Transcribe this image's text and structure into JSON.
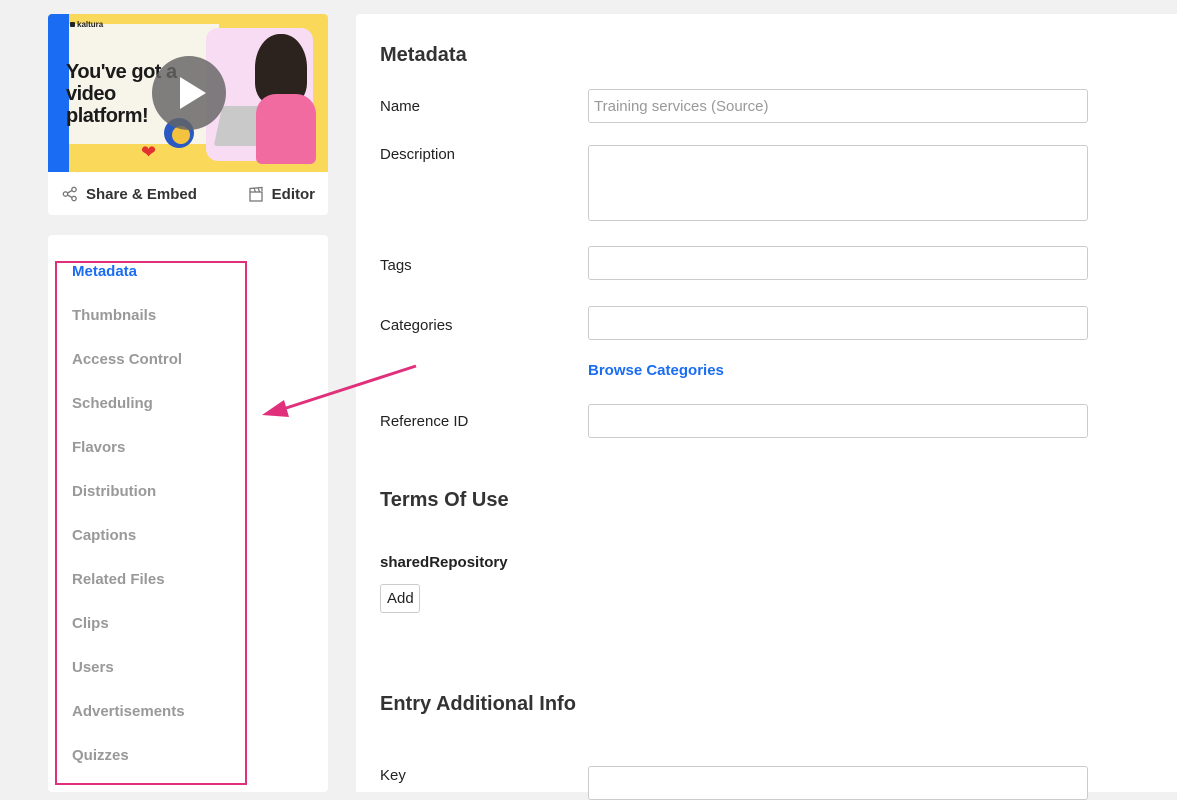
{
  "video": {
    "brand": "kaltura",
    "headline": "You've got a video platform!"
  },
  "actions": {
    "share_label": "Share & Embed",
    "editor_label": "Editor"
  },
  "nav": {
    "items": [
      {
        "label": "Metadata",
        "active": true
      },
      {
        "label": "Thumbnails"
      },
      {
        "label": "Access Control"
      },
      {
        "label": "Scheduling"
      },
      {
        "label": "Flavors"
      },
      {
        "label": "Distribution"
      },
      {
        "label": "Captions"
      },
      {
        "label": "Related Files"
      },
      {
        "label": "Clips"
      },
      {
        "label": "Users"
      },
      {
        "label": "Advertisements"
      },
      {
        "label": "Quizzes"
      }
    ]
  },
  "metadata": {
    "title": "Metadata",
    "name_label": "Name",
    "name_placeholder": "Training services (Source)",
    "description_label": "Description",
    "tags_label": "Tags",
    "categories_label": "Categories",
    "browse_categories": "Browse Categories",
    "reference_id_label": "Reference ID"
  },
  "terms": {
    "title": "Terms Of Use",
    "shared_repository_label": "sharedRepository",
    "add_button": "Add"
  },
  "additional": {
    "title": "Entry Additional Info",
    "key_label": "Key"
  },
  "colors": {
    "accent": "#1a6df2",
    "highlight": "#e0307c",
    "nav_inactive": "#999999"
  }
}
